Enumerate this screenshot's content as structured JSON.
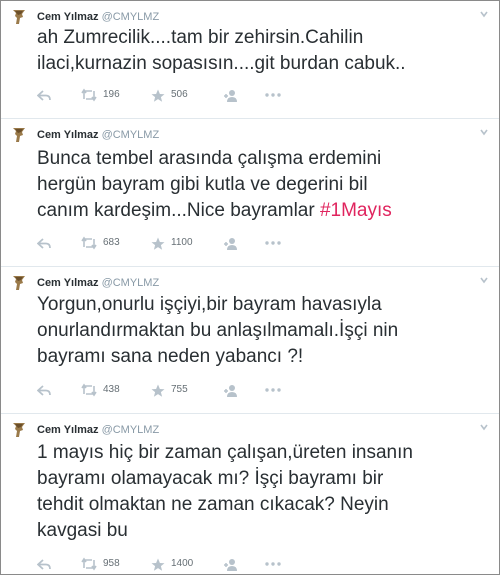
{
  "tweets": [
    {
      "name": "Cem Yılmaz",
      "handle": "@CMYLMZ",
      "text_lines": [
        "ah Zumrecilik....tam bir zehirsin.Cahilin",
        "ilaci,kurnazin sopasısın....git burdan cabuk.."
      ],
      "hashtag": "",
      "retweets": "196",
      "favorites": "506"
    },
    {
      "name": "Cem Yılmaz",
      "handle": "@CMYLMZ",
      "text_lines": [
        "Bunca tembel arasında çalışma erdemini",
        "hergün bayram gibi kutla ve degerini bil",
        "canım kardeşim...Nice bayramlar "
      ],
      "hashtag": "#1Mayıs",
      "retweets": "683",
      "favorites": "1100"
    },
    {
      "name": "Cem Yılmaz",
      "handle": "@CMYLMZ",
      "text_lines": [
        "Yorgun,onurlu işçiyi,bir bayram havasıyla",
        "onurlandırmaktan bu anlaşılmamalı.İşçi nin",
        "bayramı sana neden yabancı ?!"
      ],
      "hashtag": "",
      "retweets": "438",
      "favorites": "755"
    },
    {
      "name": "Cem Yılmaz",
      "handle": "@CMYLMZ",
      "text_lines": [
        "1 mayıs hiç bir zaman çalışan,üreten insanın",
        "bayramı olamayacak mı? İşçi bayramı bir",
        "tehdit olmaktan ne zaman cıkacak? Neyin",
        "kavgasi bu"
      ],
      "hashtag": "",
      "retweets": "958",
      "favorites": "1400"
    }
  ],
  "icons": {
    "reply": "reply-icon",
    "retweet": "retweet-icon",
    "favorite": "star-icon",
    "follow": "follow-icon",
    "more": "more-icon",
    "caret": "chevron-down-icon"
  },
  "colors": {
    "hashtag": "#e0245e",
    "action_icon": "#b7c2cb",
    "handle": "#8899a6",
    "text": "#292f33"
  }
}
